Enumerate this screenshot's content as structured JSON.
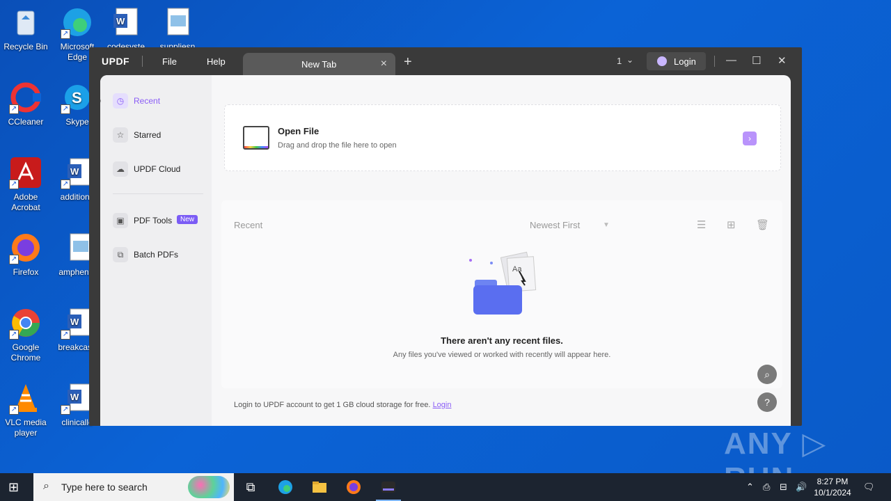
{
  "desktop": {
    "icons": [
      {
        "label": "Recycle Bin",
        "icon": "recycle-bin-icon"
      },
      {
        "label": "Microsoft Edge",
        "icon": "edge-icon"
      },
      {
        "label": "codesyste",
        "icon": "word-doc-icon"
      },
      {
        "label": "suppliesn",
        "icon": "image-file-icon"
      },
      {
        "label": "CCleaner",
        "icon": "ccleaner-icon"
      },
      {
        "label": "Skype",
        "icon": "skype-icon"
      },
      {
        "label": "Adobe Acrobat",
        "icon": "acrobat-icon"
      },
      {
        "label": "additionn",
        "icon": "word-doc-icon"
      },
      {
        "label": "Firefox",
        "icon": "firefox-icon"
      },
      {
        "label": "amphente",
        "icon": "image-file-icon"
      },
      {
        "label": "Google Chrome",
        "icon": "chrome-icon"
      },
      {
        "label": "breakcase",
        "icon": "word-doc-icon"
      },
      {
        "label": "VLC media player",
        "icon": "vlc-icon"
      },
      {
        "label": "clinicallo",
        "icon": "word-doc-icon"
      }
    ],
    "watermark": "ANY ▷ RUN"
  },
  "app": {
    "logo": "UPDF",
    "menu": {
      "file": "File",
      "help": "Help"
    },
    "tab": {
      "title": "New Tab",
      "close": "×"
    },
    "new_tab": "+",
    "tab_count": "1",
    "login": "Login",
    "window_controls": {
      "minimize": "—",
      "maximize": "☐",
      "close": "✕"
    }
  },
  "sidebar": {
    "items": [
      {
        "label": "Recent",
        "icon": "clock-icon",
        "active": true
      },
      {
        "label": "Starred",
        "icon": "star-icon"
      },
      {
        "label": "UPDF Cloud",
        "icon": "cloud-icon"
      },
      {
        "label": "PDF Tools",
        "icon": "toolbox-icon",
        "badge": "New"
      },
      {
        "label": "Batch PDFs",
        "icon": "batch-icon"
      }
    ]
  },
  "open_file": {
    "title": "Open File",
    "subtitle": "Drag and drop the file here to open"
  },
  "recent": {
    "label": "Recent",
    "sort": "Newest First",
    "empty_title": "There aren't any recent files.",
    "empty_subtitle": "Any files you've viewed or worked with recently will appear here."
  },
  "footer": {
    "note": "Login to UPDF account to get 1 GB cloud storage for free.",
    "link": "Login"
  },
  "taskbar": {
    "search_placeholder": "Type here to search",
    "time": "8:27 PM",
    "date": "10/1/2024"
  },
  "colors": {
    "accent": "#8a5cf6",
    "badge": "#7b5cf5",
    "desktop": "#0b63d6",
    "taskbar": "#1c2430"
  }
}
